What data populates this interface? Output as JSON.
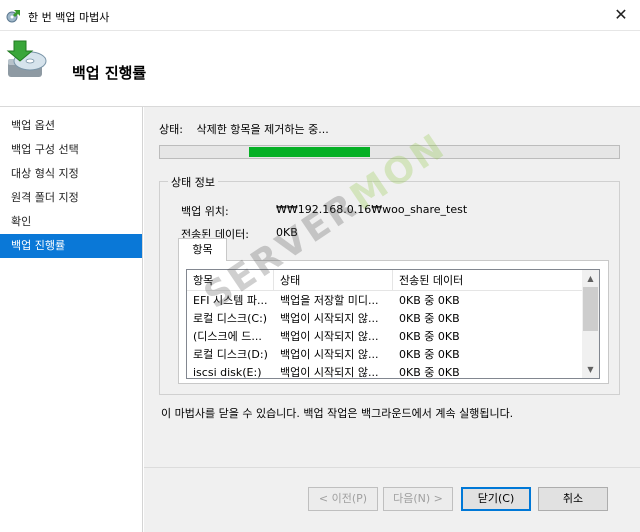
{
  "window": {
    "title": "한 번 백업 마법사",
    "close_glyph": "✕"
  },
  "header": {
    "heading": "백업 진행률"
  },
  "sidebar": {
    "items": [
      {
        "label": "백업 옵션"
      },
      {
        "label": "백업 구성 선택"
      },
      {
        "label": "대상 형식 지정"
      },
      {
        "label": "원격 폴더 지정"
      },
      {
        "label": "확인"
      },
      {
        "label": "백업 진행률"
      }
    ],
    "active_index": 5
  },
  "status": {
    "label": "상태:",
    "value": "삭제한 항목을 제거하는 중..."
  },
  "progress": {
    "indeterminate": true,
    "color": "#06b025"
  },
  "status_info": {
    "legend": "상태 정보",
    "location_label": "백업 위치:",
    "location_value": "₩₩192.168.0.16₩woo_share_test",
    "transferred_label": "전송된 데이터:",
    "transferred_value": "0KB"
  },
  "tab": {
    "label": "항목"
  },
  "table": {
    "columns": [
      "항목",
      "상태",
      "전송된 데이터"
    ],
    "rows": [
      [
        "EFI 시스템 파...",
        "백업을 저장할 미디...",
        "0KB 중 0KB"
      ],
      [
        "로컬 디스크(C:)",
        "백업이 시작되지 않...",
        "0KB 중 0KB"
      ],
      [
        "(디스크에 드...",
        "백업이 시작되지 않...",
        "0KB 중 0KB"
      ],
      [
        "로컬 디스크(D:)",
        "백업이 시작되지 않...",
        "0KB 중 0KB"
      ],
      [
        "iscsi disk(E:)",
        "백업이 시작되지 않...",
        "0KB 중 0KB"
      ]
    ]
  },
  "note": "이 마법사를 닫을 수 있습니다. 백업 작업은 백그라운드에서 계속 실행됩니다.",
  "buttons": {
    "prev": "< 이전(P)",
    "next": "다음(N) >",
    "close": "닫기(C)",
    "cancel": "취소"
  },
  "watermark": {
    "part1": "SERVER",
    "part2": "MON"
  }
}
